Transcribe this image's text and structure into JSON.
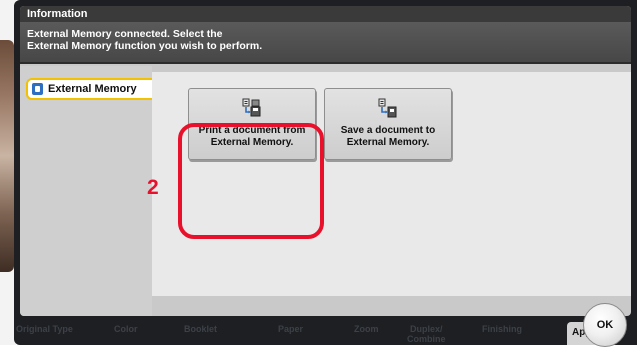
{
  "window": {
    "title": "Information",
    "message_lines": [
      "External Memory connected. Select the",
      "External Memory function you wish to perform."
    ]
  },
  "sidebar": {
    "tab_label": "External Memory",
    "tab_icon": "usb-memory-icon"
  },
  "functions": {
    "print": {
      "label_lines": [
        "Print a document from",
        "External Memory."
      ],
      "icon": "print-from-memory-icon"
    },
    "save": {
      "label_lines": [
        "Save a document to",
        "External Memory."
      ],
      "icon": "save-to-memory-icon"
    }
  },
  "annotation": {
    "step_number": "2",
    "highlight_color": "#e8102a"
  },
  "bottom_tabs": [
    "Original Type",
    "Color",
    "Booklet",
    "Paper",
    "Zoom",
    "Duplex/",
    "Combine",
    "Finishing"
  ],
  "app_tab_label": "App",
  "ok_button_label": "OK",
  "colors": {
    "tab_highlight": "#f3c100",
    "annotation_red": "#e8102a",
    "info_bar": "#3a3a3a"
  }
}
